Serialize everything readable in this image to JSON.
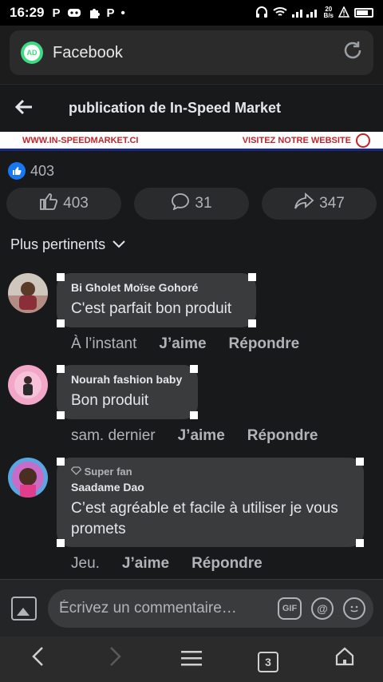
{
  "status_bar": {
    "time": "16:29",
    "left_icons": [
      "P",
      "game-icon",
      "puzzle-icon",
      "P",
      "•"
    ],
    "speed_top": "20",
    "speed_bottom": "B/s"
  },
  "browser": {
    "badge": "AD",
    "url": "Facebook"
  },
  "header": {
    "back_icon": "←",
    "title": "publication de In-Speed Market"
  },
  "banner": {
    "left": "WWW.IN-SPEEDMARKET.CI",
    "right": "VISITEZ NOTRE WEBSITE"
  },
  "reactions": {
    "count": "403"
  },
  "actions": {
    "like_count": "403",
    "comment_count": "31",
    "share_count": "347"
  },
  "sort": {
    "label": "Plus pertinents",
    "chevron": "⌄"
  },
  "comments": [
    {
      "author": "Bi Gholet Moïse Gohoré",
      "text": "C'est parfait bon produit",
      "time": "À l’instant",
      "like": "J’aime",
      "reply": "Répondre"
    },
    {
      "author": "Nourah fashion baby",
      "text": "Bon produit",
      "time": "sam. dernier",
      "like": "J’aime",
      "reply": "Répondre"
    },
    {
      "badge": "Super fan",
      "author": "Saadame Dao",
      "text": "C’est agréable et facile à utiliser je vous promets",
      "time": "Jeu.",
      "like": "J’aime",
      "reply": "Répondre"
    }
  ],
  "composer": {
    "placeholder": "Écrivez un commentaire…",
    "gif": "GIF",
    "mention": "@"
  },
  "navbar": {
    "tab_count": "3"
  },
  "colors": {
    "accent": "#1877f2",
    "background": "#18191a",
    "bubble": "#3a3b3c",
    "banner_red": "#c0252b"
  }
}
